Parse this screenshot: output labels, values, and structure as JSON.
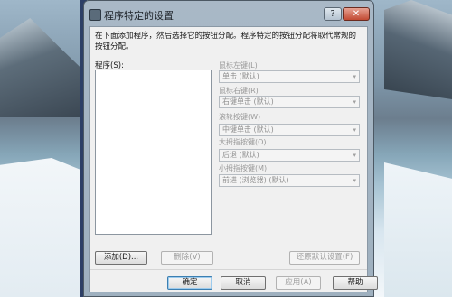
{
  "window": {
    "title": "程序特定的设置",
    "help_label": "?",
    "close_label": "✕"
  },
  "description": "在下面添加程序，然后选择它的按钮分配。程序特定的按钮分配将取代常规的按钮分配。",
  "list_label": "程序(S):",
  "fields": [
    {
      "label": "鼠标左键(L)",
      "value": "单击 (默认)"
    },
    {
      "label": "鼠标右键(R)",
      "value": "右键单击 (默认)"
    },
    {
      "label": "滚轮按键(W)",
      "value": "中键单击 (默认)"
    },
    {
      "label": "大拇指按键(O)",
      "value": "后退 (默认)"
    },
    {
      "label": "小拇指按键(M)",
      "value": "前进 (浏览器) (默认)"
    }
  ],
  "buttons": {
    "add": "添加(D)...",
    "delete": "删除(V)",
    "restore": "还原默认设置(F)",
    "ok": "确定",
    "cancel": "取消",
    "apply": "应用(A)",
    "help": "帮助"
  },
  "icons": {
    "dropdown": "▾"
  }
}
